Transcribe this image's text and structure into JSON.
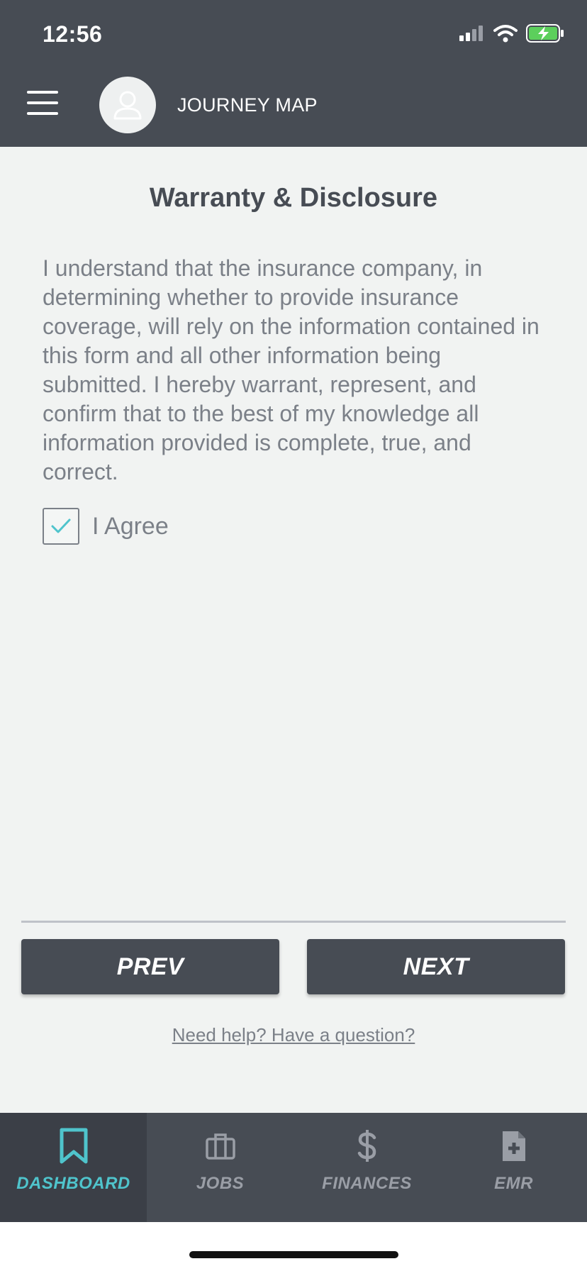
{
  "status_bar": {
    "time": "12:56"
  },
  "header": {
    "title": "JOURNEY MAP"
  },
  "page": {
    "title": "Warranty & Disclosure",
    "disclosure": "I understand that the insurance company, in determining whether to provide insurance coverage, will rely on the information contained in this form and all other information being submitted. I hereby warrant, represent, and confirm that to the best of my knowledge all information provided is complete, true, and correct.",
    "agree_label": "I Agree",
    "agree_checked": true
  },
  "buttons": {
    "prev": "PREV",
    "next": "NEXT"
  },
  "help_link": "Need help? Have a question?",
  "tabs": [
    {
      "label": "DASHBOARD",
      "icon": "bookmark-icon",
      "active": true
    },
    {
      "label": "JOBS",
      "icon": "briefcase-icon",
      "active": false
    },
    {
      "label": "FINANCES",
      "icon": "dollar-icon",
      "active": false
    },
    {
      "label": "EMR",
      "icon": "medical-document-icon",
      "active": false
    }
  ],
  "colors": {
    "header_bg": "#474c54",
    "accent": "#4fc4cc",
    "text": "#7b8088",
    "background": "#f1f3f2"
  }
}
